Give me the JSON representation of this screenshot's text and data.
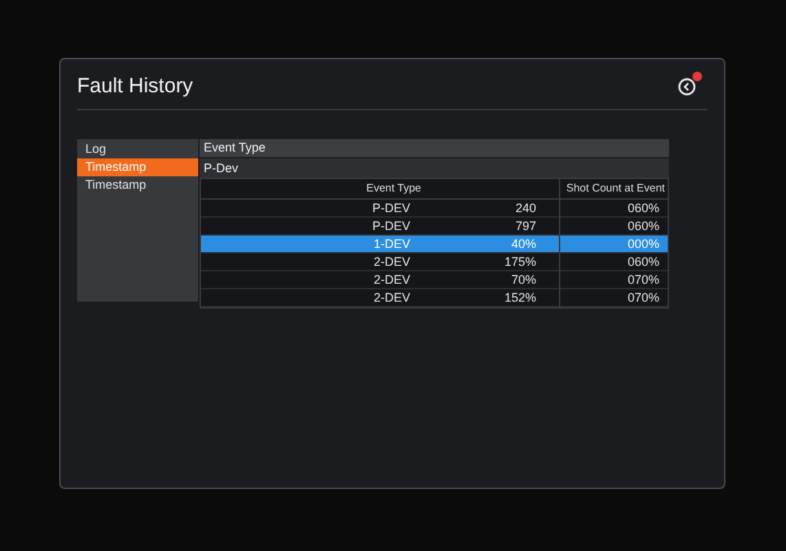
{
  "panel": {
    "title": "Fault History",
    "back_button": {
      "alert": true
    }
  },
  "sidebar": {
    "items": [
      {
        "label": "Log",
        "selected": false
      },
      {
        "label": "Timestamp",
        "selected": true
      },
      {
        "label": "Timestamp",
        "selected": false
      }
    ]
  },
  "detail": {
    "header": "Event Type",
    "value": "P-Dev"
  },
  "table": {
    "columns": [
      "Event Type",
      "",
      "Shot Count at Event"
    ],
    "rows": [
      {
        "cells": [
          "P-DEV",
          "240",
          "060%"
        ],
        "selected": false
      },
      {
        "cells": [
          "P-DEV",
          "797",
          "060%"
        ],
        "selected": false
      },
      {
        "cells": [
          "1-DEV",
          "40%",
          "000%"
        ],
        "selected": true
      },
      {
        "cells": [
          "2-DEV",
          "175%",
          "060%"
        ],
        "selected": false
      },
      {
        "cells": [
          "2-DEV",
          "70%",
          "070%"
        ],
        "selected": false
      },
      {
        "cells": [
          "2-DEV",
          "152%",
          "070%"
        ],
        "selected": false
      }
    ]
  }
}
